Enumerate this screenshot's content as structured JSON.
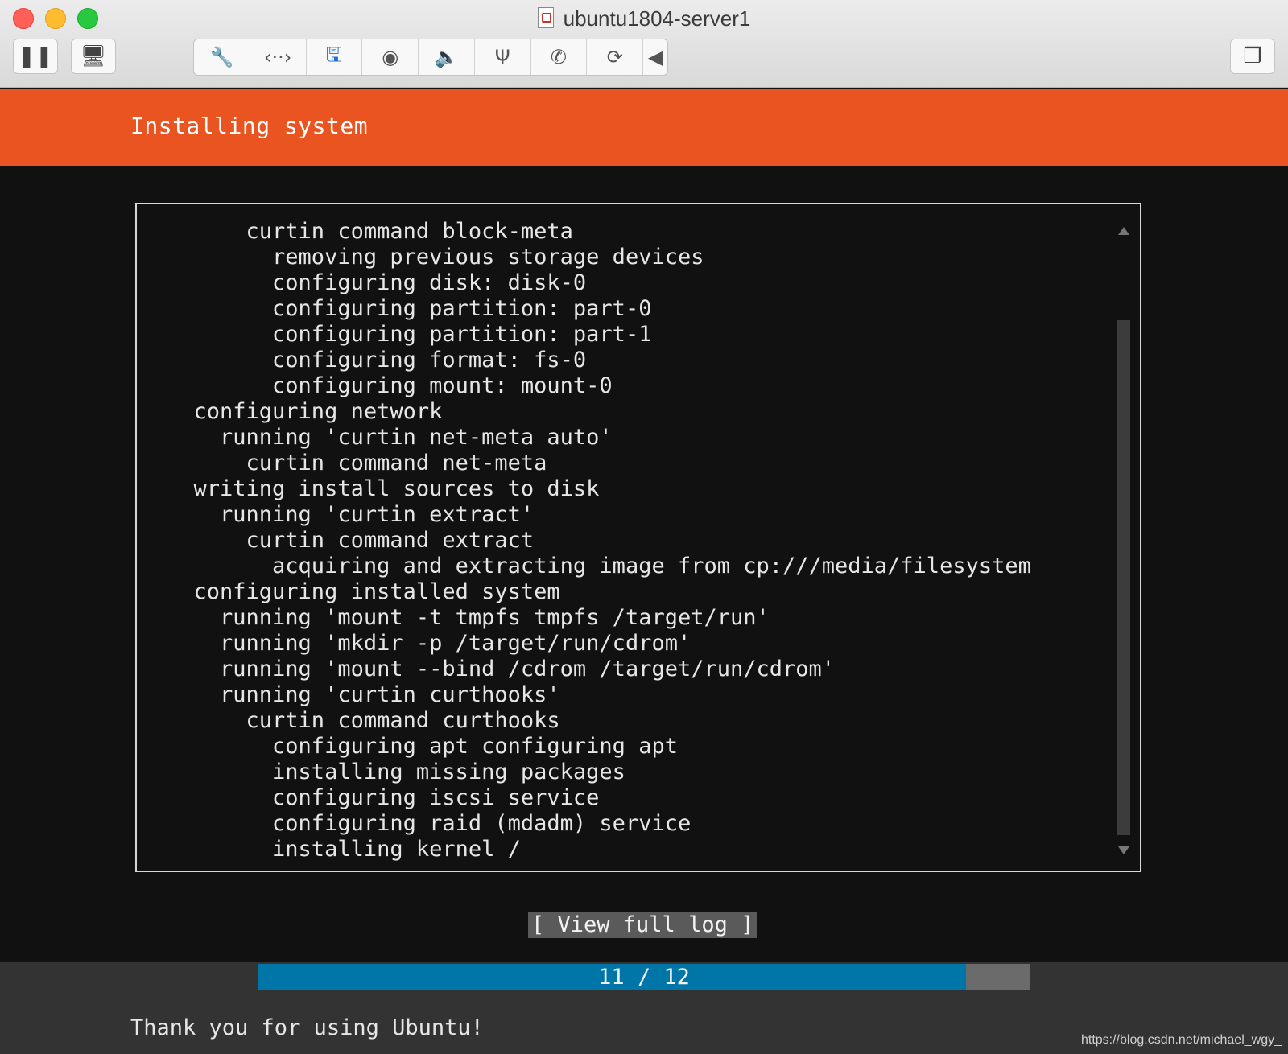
{
  "window": {
    "title": "ubuntu1804-server1"
  },
  "toolbar": {
    "pause_glyph": "❚❚",
    "snapshot_glyph": "🖥",
    "settings_glyph": "🔧",
    "network_glyph": "‹··›",
    "disk_glyph": "🖫",
    "camera_glyph": "◉",
    "sound_glyph": "🔈",
    "usb_glyph": "Ψ",
    "printer_glyph": "✆",
    "shared_glyph": "⟳",
    "collapse_glyph": "◀",
    "fullscreen_glyph": "❐"
  },
  "installer": {
    "header_title": "Installing system",
    "log_lines": [
      "      curtin command block-meta",
      "        removing previous storage devices",
      "        configuring disk: disk-0",
      "        configuring partition: part-0",
      "        configuring partition: part-1",
      "        configuring format: fs-0",
      "        configuring mount: mount-0",
      "  configuring network",
      "    running 'curtin net-meta auto'",
      "      curtin command net-meta",
      "  writing install sources to disk",
      "    running 'curtin extract'",
      "      curtin command extract",
      "        acquiring and extracting image from cp:///media/filesystem",
      "  configuring installed system",
      "    running 'mount -t tmpfs tmpfs /target/run'",
      "    running 'mkdir -p /target/run/cdrom'",
      "    running 'mount --bind /cdrom /target/run/cdrom'",
      "    running 'curtin curthooks'",
      "      curtin command curthooks",
      "        configuring apt configuring apt",
      "        installing missing packages",
      "        configuring iscsi service",
      "        configuring raid (mdadm) service",
      "        installing kernel /"
    ],
    "view_log_button": "[ View full log ]",
    "progress": {
      "label": "11 / 12",
      "fraction": 0.917
    },
    "footer_message": "Thank you for using Ubuntu!"
  },
  "watermark": "https://blog.csdn.net/michael_wgy_",
  "colors": {
    "header": "#e95420",
    "progress_fill": "#0076a8",
    "background": "#111111"
  }
}
